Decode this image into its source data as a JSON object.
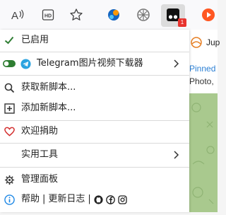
{
  "toolbar": {
    "icons": [
      "read-aloud-icon",
      "reader-view-icon",
      "bookmark-star-icon",
      "extension-colorful-icon",
      "extension-gray-icon",
      "tampermonkey-icon",
      "play-extension-icon"
    ],
    "badge_count": "1"
  },
  "page": {
    "partial_title": "Jup",
    "pinned_text": "Pinned",
    "photo_text": "Photo,"
  },
  "menu": {
    "enabled_label": "已启用",
    "script_name": "Telegram图片视频下载器",
    "get_new_scripts": "获取新脚本...",
    "add_new_script": "添加新脚本...",
    "donate": "欢迎捐助",
    "utilities": "实用工具",
    "dashboard": "管理面板",
    "footer_help": "帮助",
    "footer_sep1": "|",
    "footer_changelog": "更新日志",
    "footer_sep2": "|"
  },
  "colors": {
    "check": "#2e7d32",
    "toggle": "#2e7d32",
    "telegram": "#2aa3e0",
    "heart": "#d32f2f",
    "info": "#1e88e5",
    "link_blue": "#1a73e8"
  }
}
